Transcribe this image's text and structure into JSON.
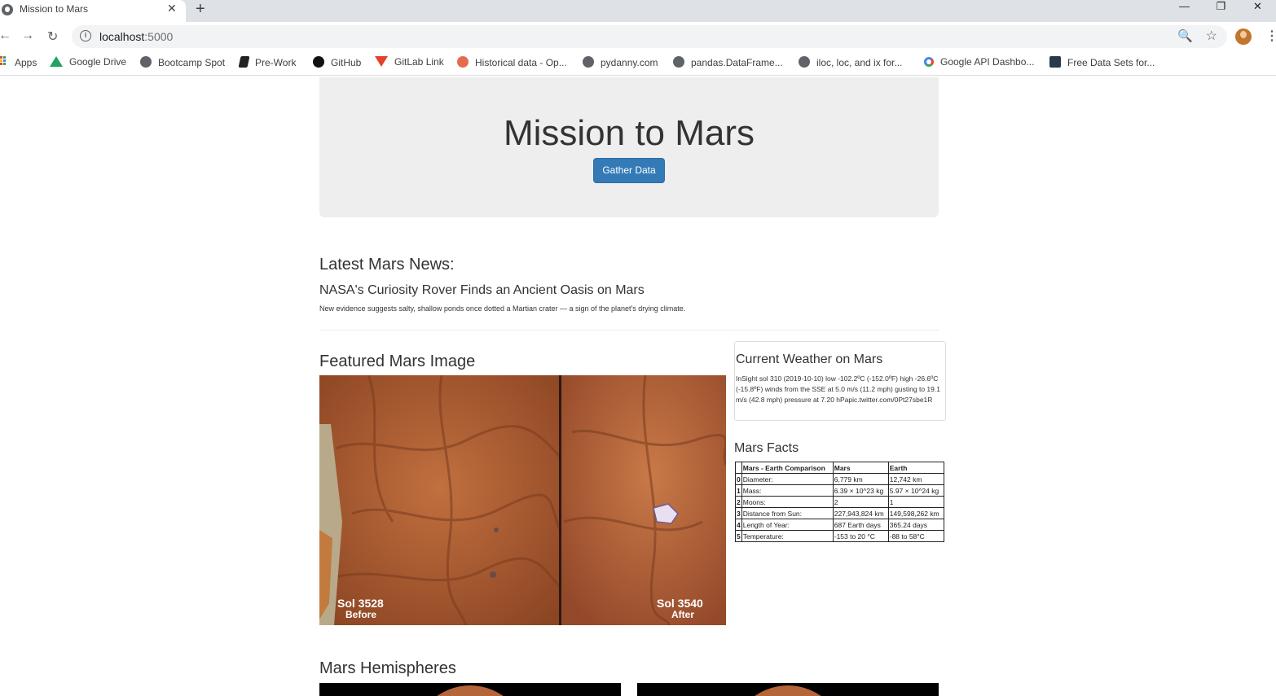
{
  "browser": {
    "tab_title": "Mission to Mars",
    "tab_close": "✕",
    "new_tab": "+",
    "window_buttons": [
      "—",
      "❐",
      "✕"
    ],
    "nav": {
      "back": "←",
      "forward": "→",
      "reload": "↻"
    },
    "url_host": "localhost",
    "url_port": ":5000",
    "zoom_glyph": "🔍",
    "star_glyph": "☆",
    "menu_glyph": "⋮",
    "bookmarks": [
      {
        "label": "Apps",
        "icon": "apps-grid-icon"
      },
      {
        "label": "Google Drive",
        "icon": "google-drive-icon"
      },
      {
        "label": "Bootcamp Spot",
        "icon": "globe-icon"
      },
      {
        "label": "Pre-Work",
        "icon": "book-icon"
      },
      {
        "label": "GitHub",
        "icon": "github-icon"
      },
      {
        "label": "GitLab Link",
        "icon": "gitlab-icon"
      },
      {
        "label": "Historical data - Op...",
        "icon": "octopus-icon"
      },
      {
        "label": "pydanny.com",
        "icon": "globe-icon"
      },
      {
        "label": "pandas.DataFrame...",
        "icon": "globe-icon"
      },
      {
        "label": "iloc, loc, and ix for...",
        "icon": "globe-icon"
      },
      {
        "label": "Google API Dashbo...",
        "icon": "google-icon"
      },
      {
        "label": "Free Data Sets for...",
        "icon": "dataset-icon"
      }
    ]
  },
  "jumbotron": {
    "title": "Mission to Mars",
    "button_label": "Gather Data"
  },
  "news": {
    "heading": "Latest Mars News:",
    "title": "NASA's Curiosity Rover Finds an Ancient Oasis on Mars",
    "paragraph": "New evidence suggests salty, shallow ponds once dotted a Martian crater — a sign of the planet's drying climate."
  },
  "featured": {
    "heading": "Featured Mars Image",
    "left_label_line1": "Sol 3528",
    "left_label_line2": "Before",
    "right_label_line1": "Sol 3540",
    "right_label_line2": "After"
  },
  "weather": {
    "heading": "Current Weather on Mars",
    "text": "InSight sol 310 (2019-10-10) low -102.2ºC (-152.0ºF) high -26.6ºC (-15.8ºF) winds from the SSE at 5.0 m/s (11.2 mph) gusting to 19.1 m/s (42.8 mph) pressure at 7.20 hPapic.twitter.com/0Pt27sbe1R"
  },
  "facts": {
    "heading": "Mars Facts",
    "columns": [
      "",
      "Mars - Earth Comparison",
      "Mars",
      "Earth"
    ],
    "rows": [
      [
        "0",
        "Diameter:",
        "6,779 km",
        "12,742 km"
      ],
      [
        "1",
        "Mass:",
        "6.39 × 10^23 kg",
        "5.97 × 10^24 kg"
      ],
      [
        "2",
        "Moons:",
        "2",
        "1"
      ],
      [
        "3",
        "Distance from Sun:",
        "227,943,824 km",
        "149,598,262 km"
      ],
      [
        "4",
        "Length of Year:",
        "687 Earth days",
        "365.24 days"
      ],
      [
        "5",
        "Temperature:",
        "-153 to 20 °C",
        "-88 to 58°C"
      ]
    ]
  },
  "hemispheres": {
    "heading": "Mars Hemispheres"
  }
}
